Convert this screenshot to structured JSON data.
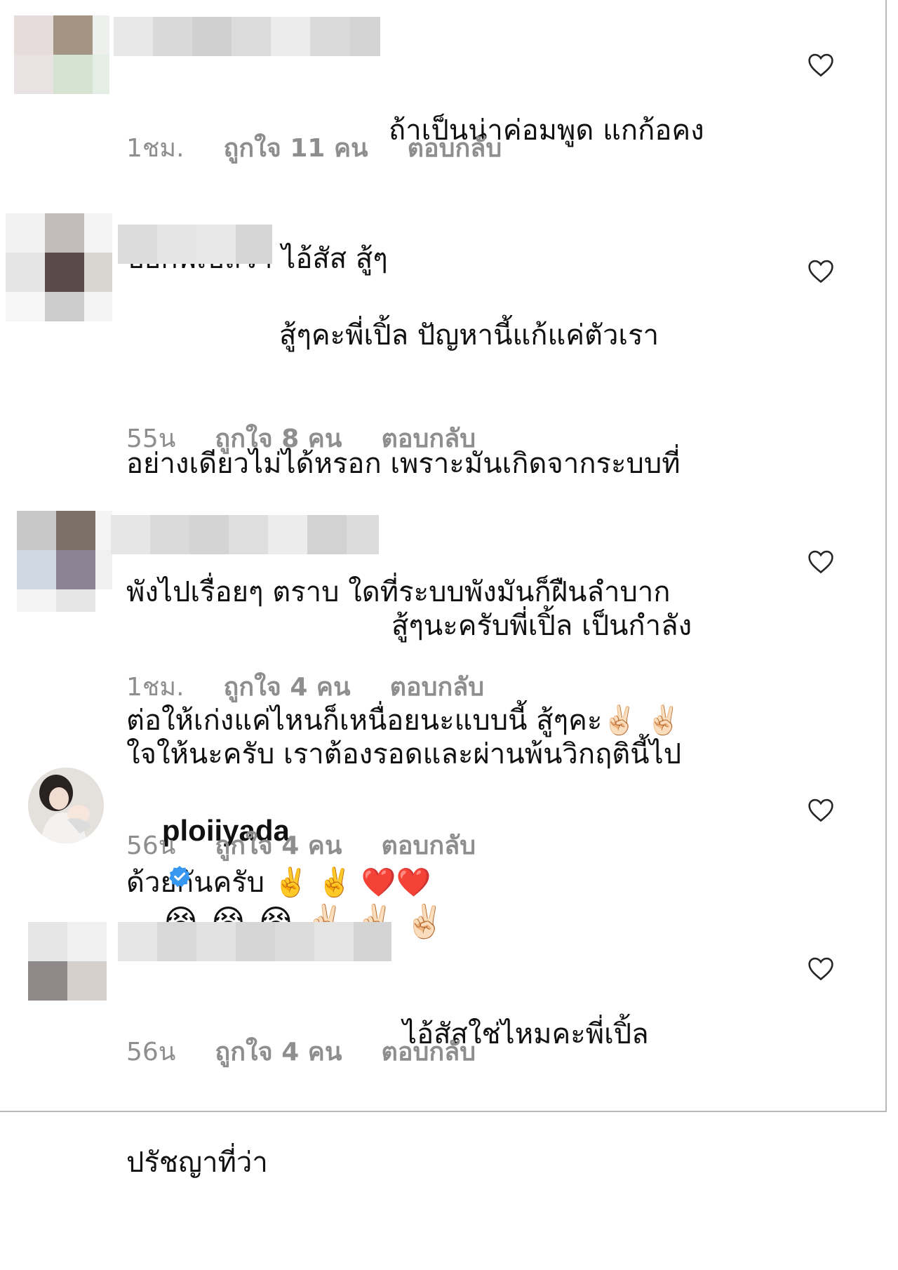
{
  "comments": [
    {
      "lines": [
        "ถ้าเป็นน่าค่อมพูด แกก้อคง",
        "บอกพี่เปิ้ลว่า ไอ้สัส สู้ๆ"
      ],
      "time": "1ชม.",
      "likes": "ถูกใจ 11 คน",
      "reply": "ตอบกลับ"
    },
    {
      "lines": [
        "สู้ๆคะพี่เปิ้ล ปัญหานี้แก้แค่ตัวเรา",
        "อย่างเดียวไม่ได้หรอก เพราะมันเกิดจากระบบที่",
        "พังไปเรื่อยๆ ตราบ ใดที่ระบบพังมันก็ฝืนลำบาก",
        "ต่อให้เก่งแค่ไหนก็เหนื่อยนะแบบนี้ สู้ๆคะ✌🏻 ✌🏻"
      ],
      "time": "55น",
      "likes": "ถูกใจ 8 คน",
      "reply": "ตอบกลับ"
    },
    {
      "lines": [
        "สู้ๆนะครับพี่เปิ้ล เป็นกำลัง",
        "ใจให้นะครับ เราต้องรอดและผ่านพ้นวิกฤตินี้ไป",
        "ด้วยกันครับ ✌️ ✌️ ❤️❤️"
      ],
      "time": "1ชม.",
      "likes": "ถูกใจ 4 คน",
      "reply": "ตอบกลับ"
    },
    {
      "username": "ploiiyada",
      "emojis": "😭😭😭✌🏻✌🏻✌🏻",
      "time": "56น",
      "likes": "ถูกใจ 4 คน",
      "reply": "ตอบกลับ"
    },
    {
      "lines": [
        "ไอ้สัสใช่ไหมคะพี่เปิ้ล",
        "ปรัชญาที่ว่า"
      ],
      "time": "56น",
      "likes": "ถูกใจ 4 คน",
      "reply": "ตอบกลับ"
    }
  ],
  "colors": {
    "meta_text": "#8e8e8e",
    "verified_blue": "#3897f0",
    "heart_outline": "#262626"
  },
  "icons": {
    "like": "heart-outline-icon",
    "verified": "verified-badge-icon"
  }
}
